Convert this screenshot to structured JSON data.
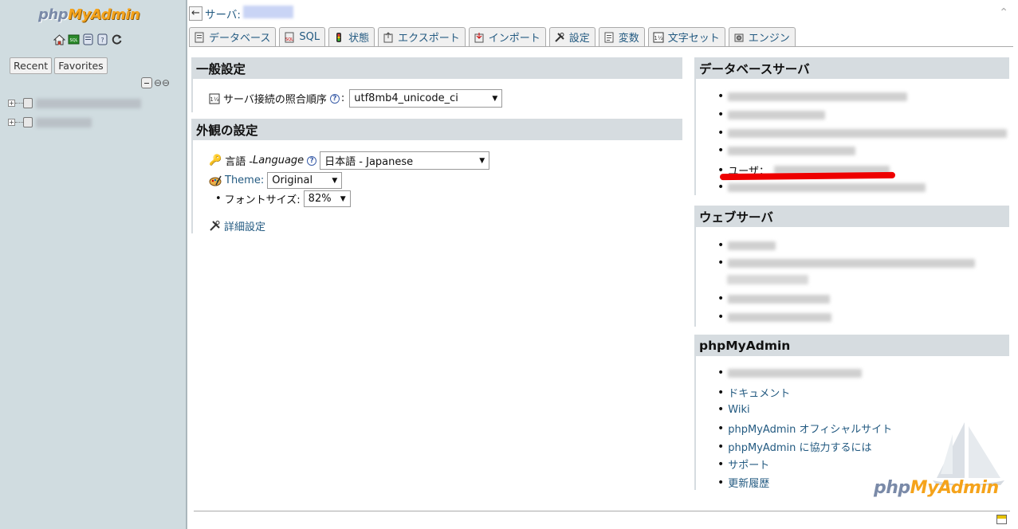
{
  "nav": {
    "logo_php": "php",
    "logo_myadmin": "MyAdmin",
    "icons": [
      "home-icon",
      "sql-query-icon",
      "docs-icon",
      "help-icon",
      "reload-icon"
    ],
    "tabs": [
      "Recent",
      "Favorites"
    ]
  },
  "topbar": {
    "back": "←",
    "server_label": "サーバ:",
    "collapse": "⌃"
  },
  "tabs": [
    {
      "label": "データベース",
      "icon": "database-icon"
    },
    {
      "label": "SQL",
      "icon": "sql-icon"
    },
    {
      "label": "状態",
      "icon": "status-icon"
    },
    {
      "label": "エクスポート",
      "icon": "export-icon"
    },
    {
      "label": "インポート",
      "icon": "import-icon"
    },
    {
      "label": "設定",
      "icon": "settings-icon"
    },
    {
      "label": "変数",
      "icon": "variables-icon"
    },
    {
      "label": "文字セット",
      "icon": "charset-icon"
    },
    {
      "label": "エンジン",
      "icon": "engine-icon"
    }
  ],
  "general": {
    "title": "一般設定",
    "collation_label": "サーバ接続の照合順序",
    "collation_value": "utf8mb4_unicode_ci"
  },
  "appearance": {
    "title": "外観の設定",
    "language_label": "言語 - ",
    "language_label_en": "Language",
    "language_value": "日本語 - Japanese",
    "theme_label": "Theme:",
    "theme_value": "Original",
    "fontsize_label": "フォントサイズ:",
    "fontsize_value": "82%",
    "more_settings": "詳細設定"
  },
  "db_server": {
    "title": "データベースサーバ",
    "user_label": "ユーザ："
  },
  "web_server": {
    "title": "ウェブサーバ"
  },
  "pma": {
    "title": "phpMyAdmin",
    "links": [
      "ドキュメント",
      "Wiki",
      "phpMyAdmin オフィシャルサイト",
      "phpMyAdmin に協力するには",
      "サポート",
      "更新履歴"
    ]
  },
  "footer_logo": {
    "php": "php",
    "myadmin": "MyAdmin"
  }
}
